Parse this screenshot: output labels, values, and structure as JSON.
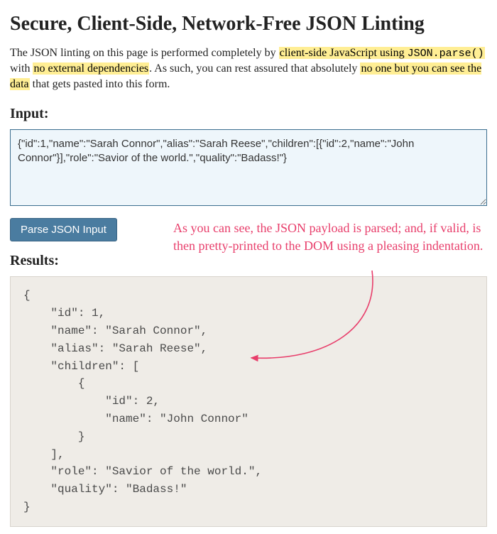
{
  "title": "Secure, Client-Side, Network-Free JSON Linting",
  "intro": {
    "p1": "The JSON linting on this page is performed completely by ",
    "hl1": "client-side JavaScript using ",
    "code": "JSON.parse()",
    "p2": " with ",
    "hl2": "no external dependencies",
    "p3": ". As such, you can rest assured that absolutely ",
    "hl3": "no one but you can see the data",
    "p4": " that gets pasted into this form."
  },
  "input_label": "Input:",
  "input_value": "{\"id\":1,\"name\":\"Sarah Connor\",\"alias\":\"Sarah Reese\",\"children\":[{\"id\":2,\"name\":\"John Connor\"}],\"role\":\"Savior of the world.\",\"quality\":\"Badass!\"}",
  "parse_button_label": "Parse JSON Input",
  "results_label": "Results:",
  "output_text": "{\n    \"id\": 1,\n    \"name\": \"Sarah Connor\",\n    \"alias\": \"Sarah Reese\",\n    \"children\": [\n        {\n            \"id\": 2,\n            \"name\": \"John Connor\"\n        }\n    ],\n    \"role\": \"Savior of the world.\",\n    \"quality\": \"Badass!\"\n}",
  "annotation": "As you can see, the JSON payload is parsed; and, if valid, is then pretty-printed to the DOM using a pleasing indentation."
}
